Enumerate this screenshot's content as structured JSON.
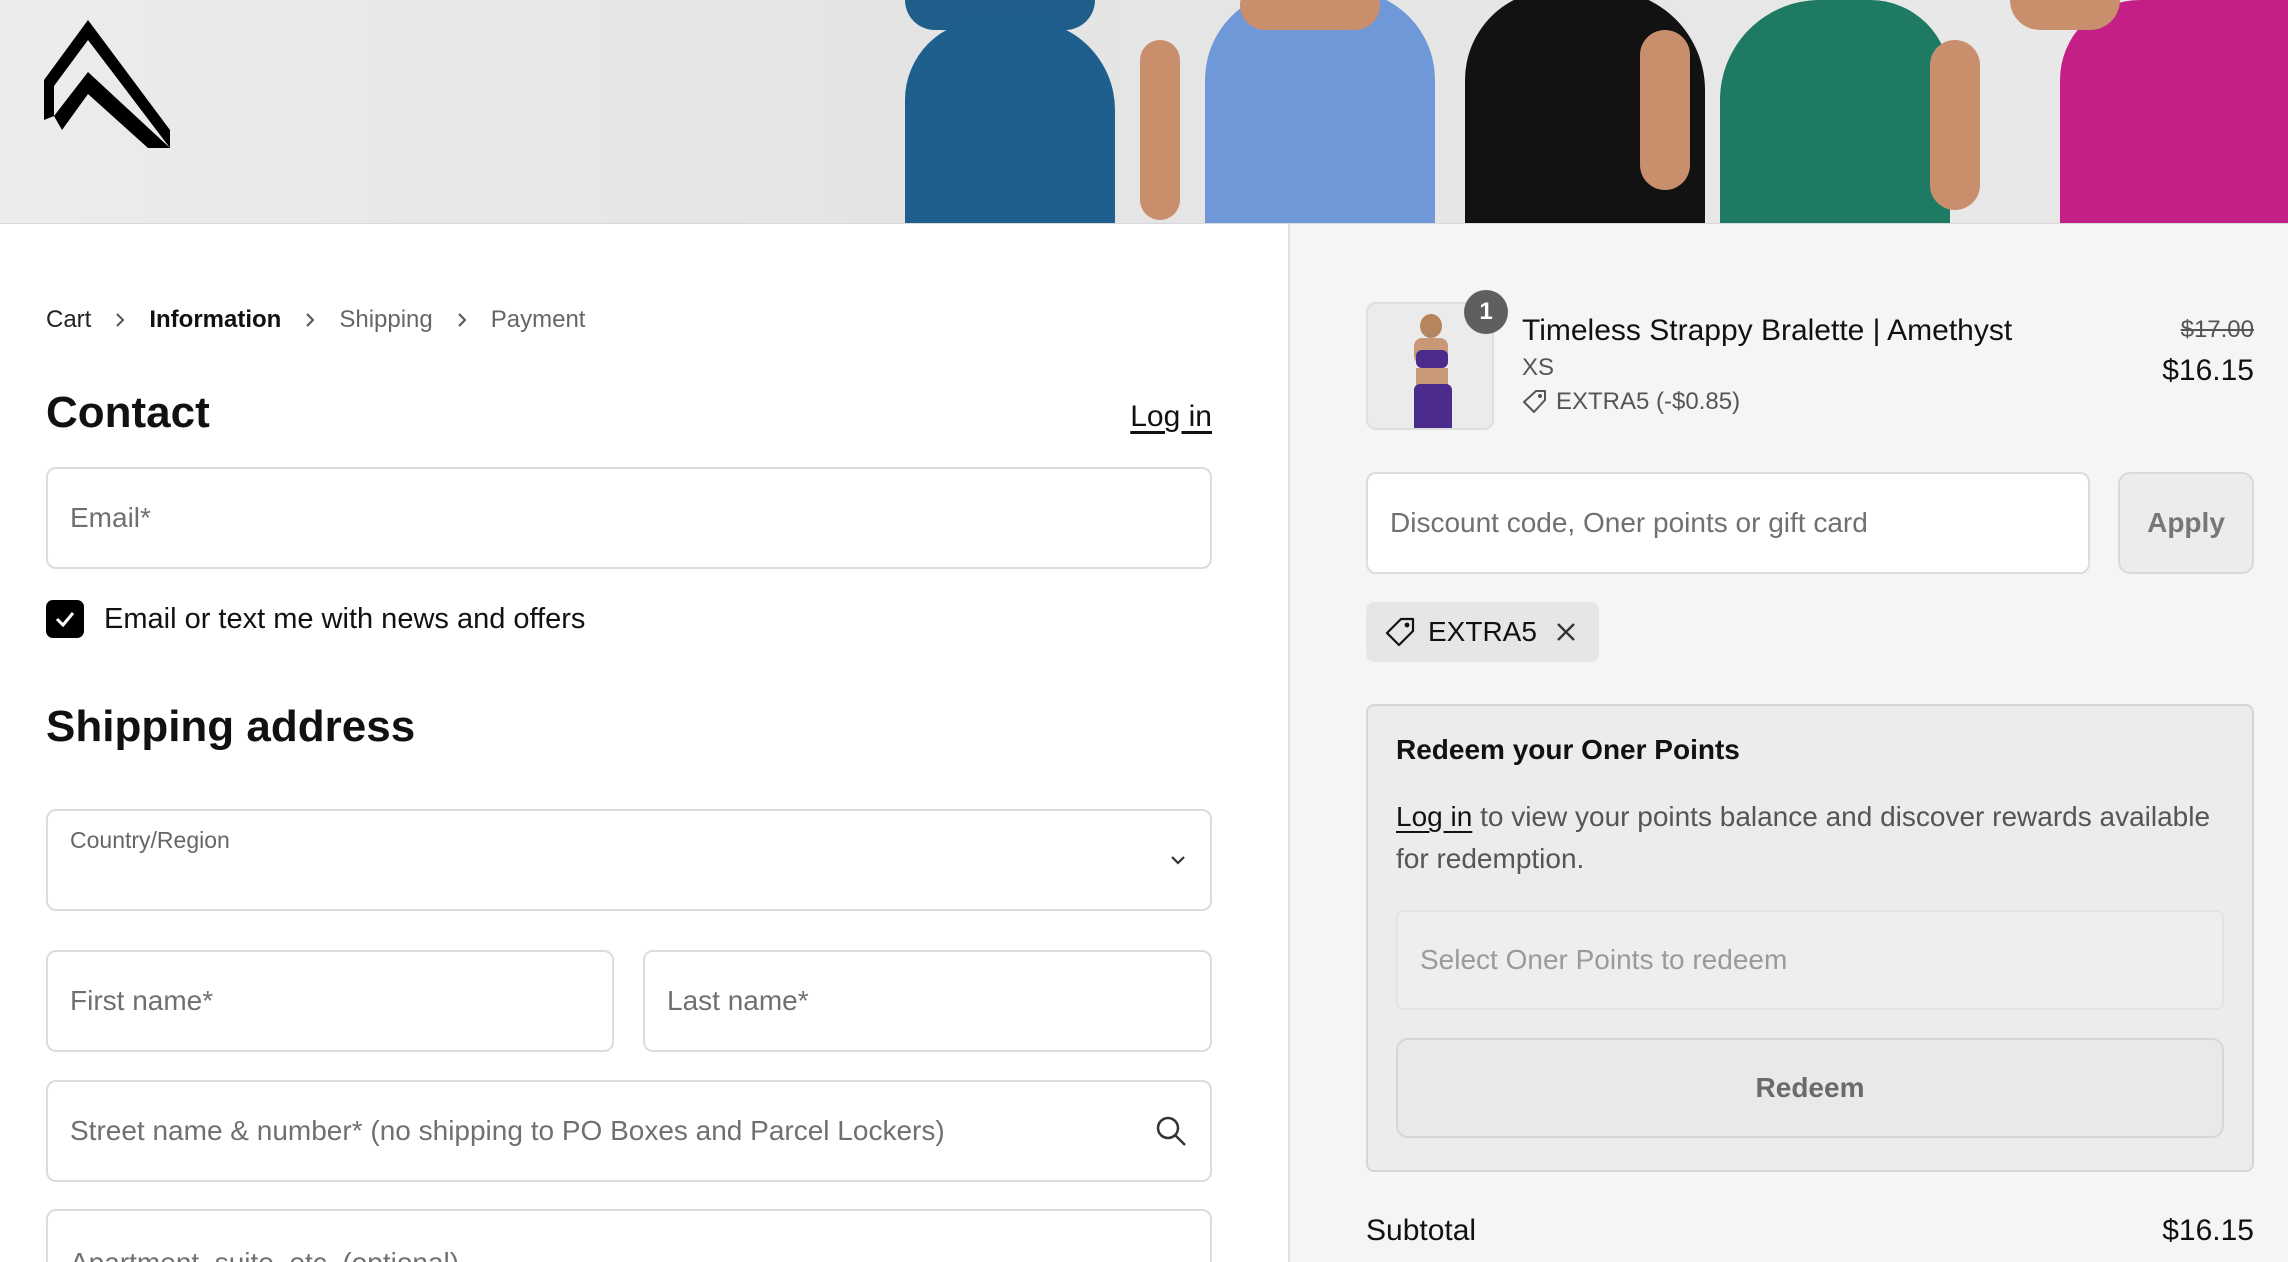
{
  "banner": {
    "logo_name": "brand-logo"
  },
  "breadcrumb": {
    "items": [
      "Cart",
      "Information",
      "Shipping",
      "Payment"
    ]
  },
  "contact": {
    "heading": "Contact",
    "login_label": "Log in",
    "email_placeholder": "Email*",
    "newsletter_label": "Email or text me with news and offers",
    "newsletter_checked": true
  },
  "shipping": {
    "heading": "Shipping address",
    "country_label": "Country/Region",
    "country_value": "",
    "first_name_placeholder": "First name*",
    "last_name_placeholder": "Last name*",
    "street_placeholder": "Street name & number* (no shipping to PO Boxes and Parcel Lockers)",
    "apartment_placeholder": "Apartment, suite, etc. (optional)"
  },
  "order": {
    "item": {
      "quantity": "1",
      "title": "Timeless Strappy Bralette | Amethyst",
      "variant": "XS",
      "discount": "EXTRA5 (-$0.85)",
      "price_original": "$17.00",
      "price_final": "$16.15"
    },
    "discount_placeholder": "Discount code, Oner points or gift card",
    "apply_label": "Apply",
    "applied_code": "EXTRA5",
    "redeem": {
      "title": "Redeem your Oner Points",
      "login_link": "Log in",
      "text_after": " to view your points balance and discover rewards available for redemption.",
      "select_placeholder": "Select Oner Points to redeem",
      "button_label": "Redeem"
    },
    "subtotal_label": "Subtotal",
    "subtotal_value": "$16.15"
  }
}
